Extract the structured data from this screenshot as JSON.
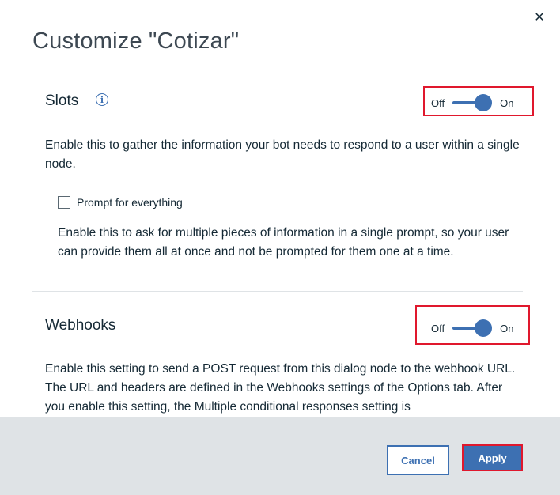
{
  "dialog": {
    "title": "Customize \"Cotizar\"",
    "close_icon": "close-icon"
  },
  "slots": {
    "heading": "Slots",
    "info_icon": "i",
    "toggle": {
      "off_label": "Off",
      "on_label": "On",
      "state": "on"
    },
    "description": "Enable this to gather the information your bot needs to respond to a user within a single node.",
    "prompt_checkbox": {
      "label": "Prompt for everything",
      "checked": false,
      "description": "Enable this to ask for multiple pieces of information in a single prompt, so your user can provide them all at once and not be prompted for them one at a time."
    }
  },
  "webhooks": {
    "heading": "Webhooks",
    "toggle": {
      "off_label": "Off",
      "on_label": "On",
      "state": "on"
    },
    "description": "Enable this setting to send a POST request from this dialog node to the webhook URL. The URL and headers are defined in the Webhooks settings of the Options tab. After you enable this setting, the Multiple conditional responses setting is"
  },
  "footer": {
    "cancel_label": "Cancel",
    "apply_label": "Apply"
  },
  "colors": {
    "accent": "#3d70b2",
    "highlight": "#e0182d",
    "footer_bg": "#dfe3e6"
  }
}
